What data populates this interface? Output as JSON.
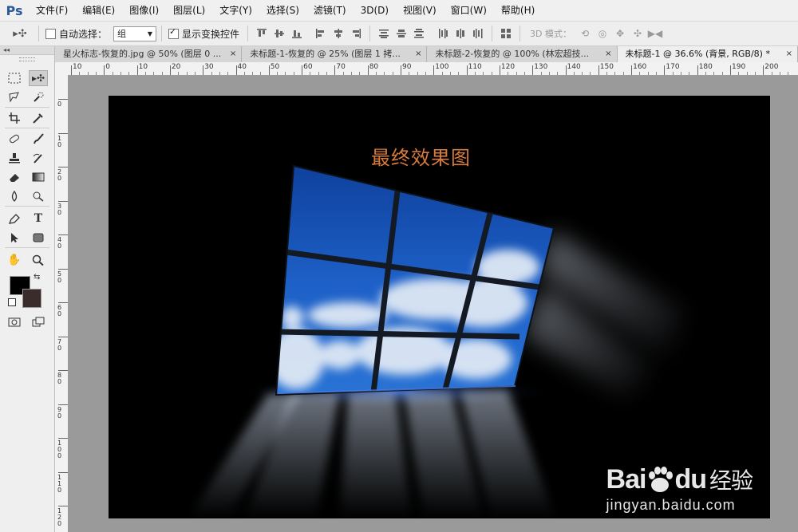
{
  "app": {
    "logo": "Ps"
  },
  "menu": [
    "文件(F)",
    "编辑(E)",
    "图像(I)",
    "图层(L)",
    "文字(Y)",
    "选择(S)",
    "滤镜(T)",
    "3D(D)",
    "视图(V)",
    "窗口(W)",
    "帮助(H)"
  ],
  "options": {
    "auto_select_label": "自动选择：",
    "auto_select_value": "组",
    "show_transform_label": "显示变换控件",
    "mode3d_label": "3D 模式："
  },
  "tabs": [
    {
      "label": "星火标志-恢复的.jpg @ 50% (图层 0 ...",
      "close": "×"
    },
    {
      "label": "未标题-1-恢复的 @ 25% (图层 1 拷...",
      "close": "×"
    },
    {
      "label": "未标题-2-恢复的 @ 100% (林宏超技...",
      "close": "×"
    },
    {
      "label": "未标题-1 @ 36.6% (背景, RGB/8) *",
      "close": "×"
    }
  ],
  "ruler": {
    "h_labels": [
      "10",
      "0",
      "10",
      "20",
      "30",
      "40",
      "50",
      "60",
      "70",
      "80",
      "90",
      "100",
      "110",
      "120",
      "130",
      "140",
      "150",
      "160",
      "170",
      "180",
      "190",
      "200"
    ],
    "v_labels": [
      "0",
      "1\n0",
      "2\n0",
      "3\n0",
      "4\n0",
      "5\n0",
      "6\n0",
      "7\n0",
      "8\n0",
      "9\n0",
      "1\n0\n0",
      "1\n1\n0",
      "1\n2\n0"
    ]
  },
  "canvas": {
    "title": "最终效果图",
    "title_color": "#d87b3a",
    "watermark_brand": "Bai",
    "watermark_brand_end": "du",
    "watermark_cn": "经验",
    "watermark_url": "jingyan.baidu.com"
  },
  "colors": {
    "foreground": "#000000",
    "background": "#3b2c2c",
    "accent": "#2a5a9b"
  },
  "tools": [
    "marquee-icon",
    "move-icon",
    "lasso-icon",
    "quick-select-icon",
    "crop-icon",
    "eyedropper-icon",
    "healing-icon",
    "brush-icon",
    "stamp-icon",
    "history-brush-icon",
    "eraser-icon",
    "gradient-icon",
    "blur-icon",
    "dodge-icon",
    "pen-icon",
    "type-icon",
    "path-select-icon",
    "shape-icon",
    "hand-icon",
    "zoom-icon",
    "quick-mask-icon",
    "screen-mode-icon"
  ]
}
